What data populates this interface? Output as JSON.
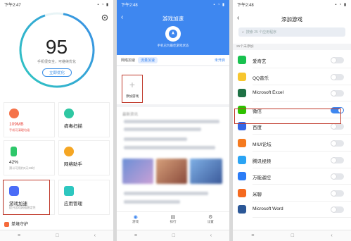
{
  "colors": {
    "accent": "#3e87f0",
    "highlight": "#c0392b",
    "ring_start": "#2ec7c0",
    "ring_end": "#3a8ee6"
  },
  "panel1": {
    "time": "下午2:47",
    "score": "95",
    "score_sub": "手机很安全，可继续优化",
    "optimize_button": "立即优化",
    "cards": [
      {
        "title": "109MB",
        "sub": "手机可清理垃圾",
        "icon": "broom-icon",
        "color": "#f5734a"
      },
      {
        "title": "病毒扫描",
        "sub": "",
        "icon": "shield-icon",
        "color": "#2ec7a2"
      },
      {
        "title": "42%",
        "sub": "预计可用约0天23时",
        "icon": "battery-icon",
        "color": "#2ec76a"
      },
      {
        "title": "网络助手",
        "sub": "",
        "icon": "network-icon",
        "color": "#f5a623"
      },
      {
        "title": "游戏加速",
        "sub": "提升游戏网络稳定性",
        "icon": "gamepad-icon",
        "color": "#4a6cf7"
      },
      {
        "title": "应用管理",
        "sub": "",
        "icon": "apps-icon",
        "color": "#2ec7c0"
      }
    ],
    "bottom_item": "单境守护"
  },
  "panel2": {
    "time": "下午2:48",
    "title": "游戏加速",
    "state": "手机已为最佳游戏状态",
    "net_label": "网络加速",
    "net_pill": "流量加速",
    "net_right": "未开启",
    "add_label": "添加游戏",
    "news_header": "最新资讯",
    "tabs": [
      {
        "label": "游戏",
        "icon": "gamepad-icon"
      },
      {
        "label": "排行",
        "icon": "rank-icon"
      },
      {
        "label": "设置",
        "icon": "gear-icon"
      }
    ]
  },
  "panel3": {
    "time": "下午2:48",
    "title": "添加游戏",
    "search_placeholder": "搜索 25 个应用程序",
    "section_label": "25个未添加",
    "apps": [
      {
        "name": "爱奇艺",
        "icon": "iqiyi-icon",
        "color": "#18c14f",
        "on": false
      },
      {
        "name": "QQ音乐",
        "icon": "qqmusic-icon",
        "color": "#f7c62e",
        "on": false
      },
      {
        "name": "Microsoft Excel",
        "icon": "excel-icon",
        "color": "#1e7145",
        "on": false
      },
      {
        "name": "微信",
        "icon": "wechat-icon",
        "color": "#2dc100",
        "on": true
      },
      {
        "name": "百度",
        "icon": "baidu-icon",
        "color": "#3466e6",
        "on": false
      },
      {
        "name": "MIUI论坛",
        "icon": "miui-forum-icon",
        "color": "#f57a1f",
        "on": false
      },
      {
        "name": "腾讯视频",
        "icon": "tencent-video-icon",
        "color": "#2aa4f4",
        "on": false
      },
      {
        "name": "万能遥控",
        "icon": "remote-icon",
        "color": "#2b7cf6",
        "on": false
      },
      {
        "name": "米聊",
        "icon": "miliao-icon",
        "color": "#f56a1f",
        "on": false
      },
      {
        "name": "Microsoft Word",
        "icon": "word-icon",
        "color": "#2b5797",
        "on": false
      }
    ]
  }
}
